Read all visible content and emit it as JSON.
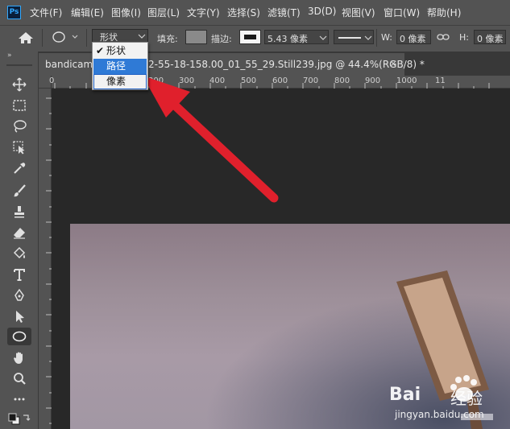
{
  "app": {
    "logo": "Ps"
  },
  "menu": [
    "文件(F)",
    "编辑(E)",
    "图像(I)",
    "图层(L)",
    "文字(Y)",
    "选择(S)",
    "滤镜(T)",
    "3D(D)",
    "视图(V)",
    "窗口(W)",
    "帮助(H)"
  ],
  "options": {
    "mode_selected": "形状",
    "fill_label": "填充:",
    "stroke_label": "描边:",
    "stroke_width": "5.43 像素",
    "w_label": "W:",
    "w_value": "0 像素",
    "h_label": "H:",
    "h_value": "0 像素"
  },
  "mode_dropdown": {
    "items": [
      "形状",
      "路径",
      "像素"
    ],
    "checked": "形状",
    "highlighted": "路径"
  },
  "document": {
    "tab_title": "bandicam 2",
    "tab_title_rest": "2-55-18-158.00_01_55_29.Still239.jpg @ 44.4%(RGB/8) *",
    "close": "×"
  },
  "ruler": {
    "labels": [
      "0",
      "100",
      "200",
      "300",
      "400",
      "500",
      "600",
      "700",
      "800",
      "900",
      "1000",
      "11"
    ]
  },
  "watermark": {
    "brand": "Bai",
    "brand2": "经验",
    "url": "jingyan.baidu.com"
  },
  "colors": {
    "ui_panel": "#535353",
    "ui_dark": "#282828",
    "highlight": "#2f7ad6",
    "arrow": "#e0202c"
  }
}
